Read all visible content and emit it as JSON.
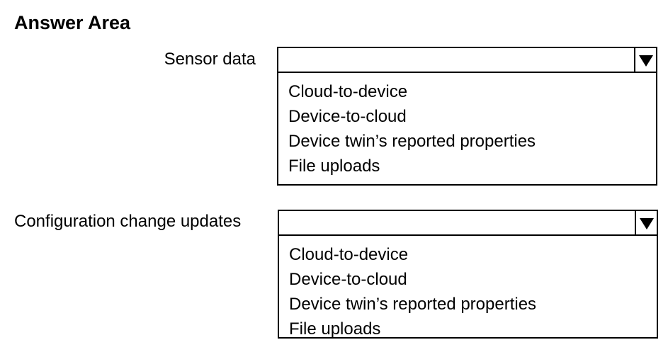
{
  "title": "Answer Area",
  "questions": [
    {
      "label": "Sensor data",
      "selected": "",
      "options": [
        "Cloud-to-device",
        "Device-to-cloud",
        "Device twin’s reported properties",
        "File uploads"
      ]
    },
    {
      "label": "Configuration change updates",
      "selected": "",
      "options": [
        "Cloud-to-device",
        "Device-to-cloud",
        "Device twin’s reported properties",
        "File uploads"
      ]
    }
  ],
  "icons": {
    "dropdown_arrow": "triangle-down-icon"
  }
}
